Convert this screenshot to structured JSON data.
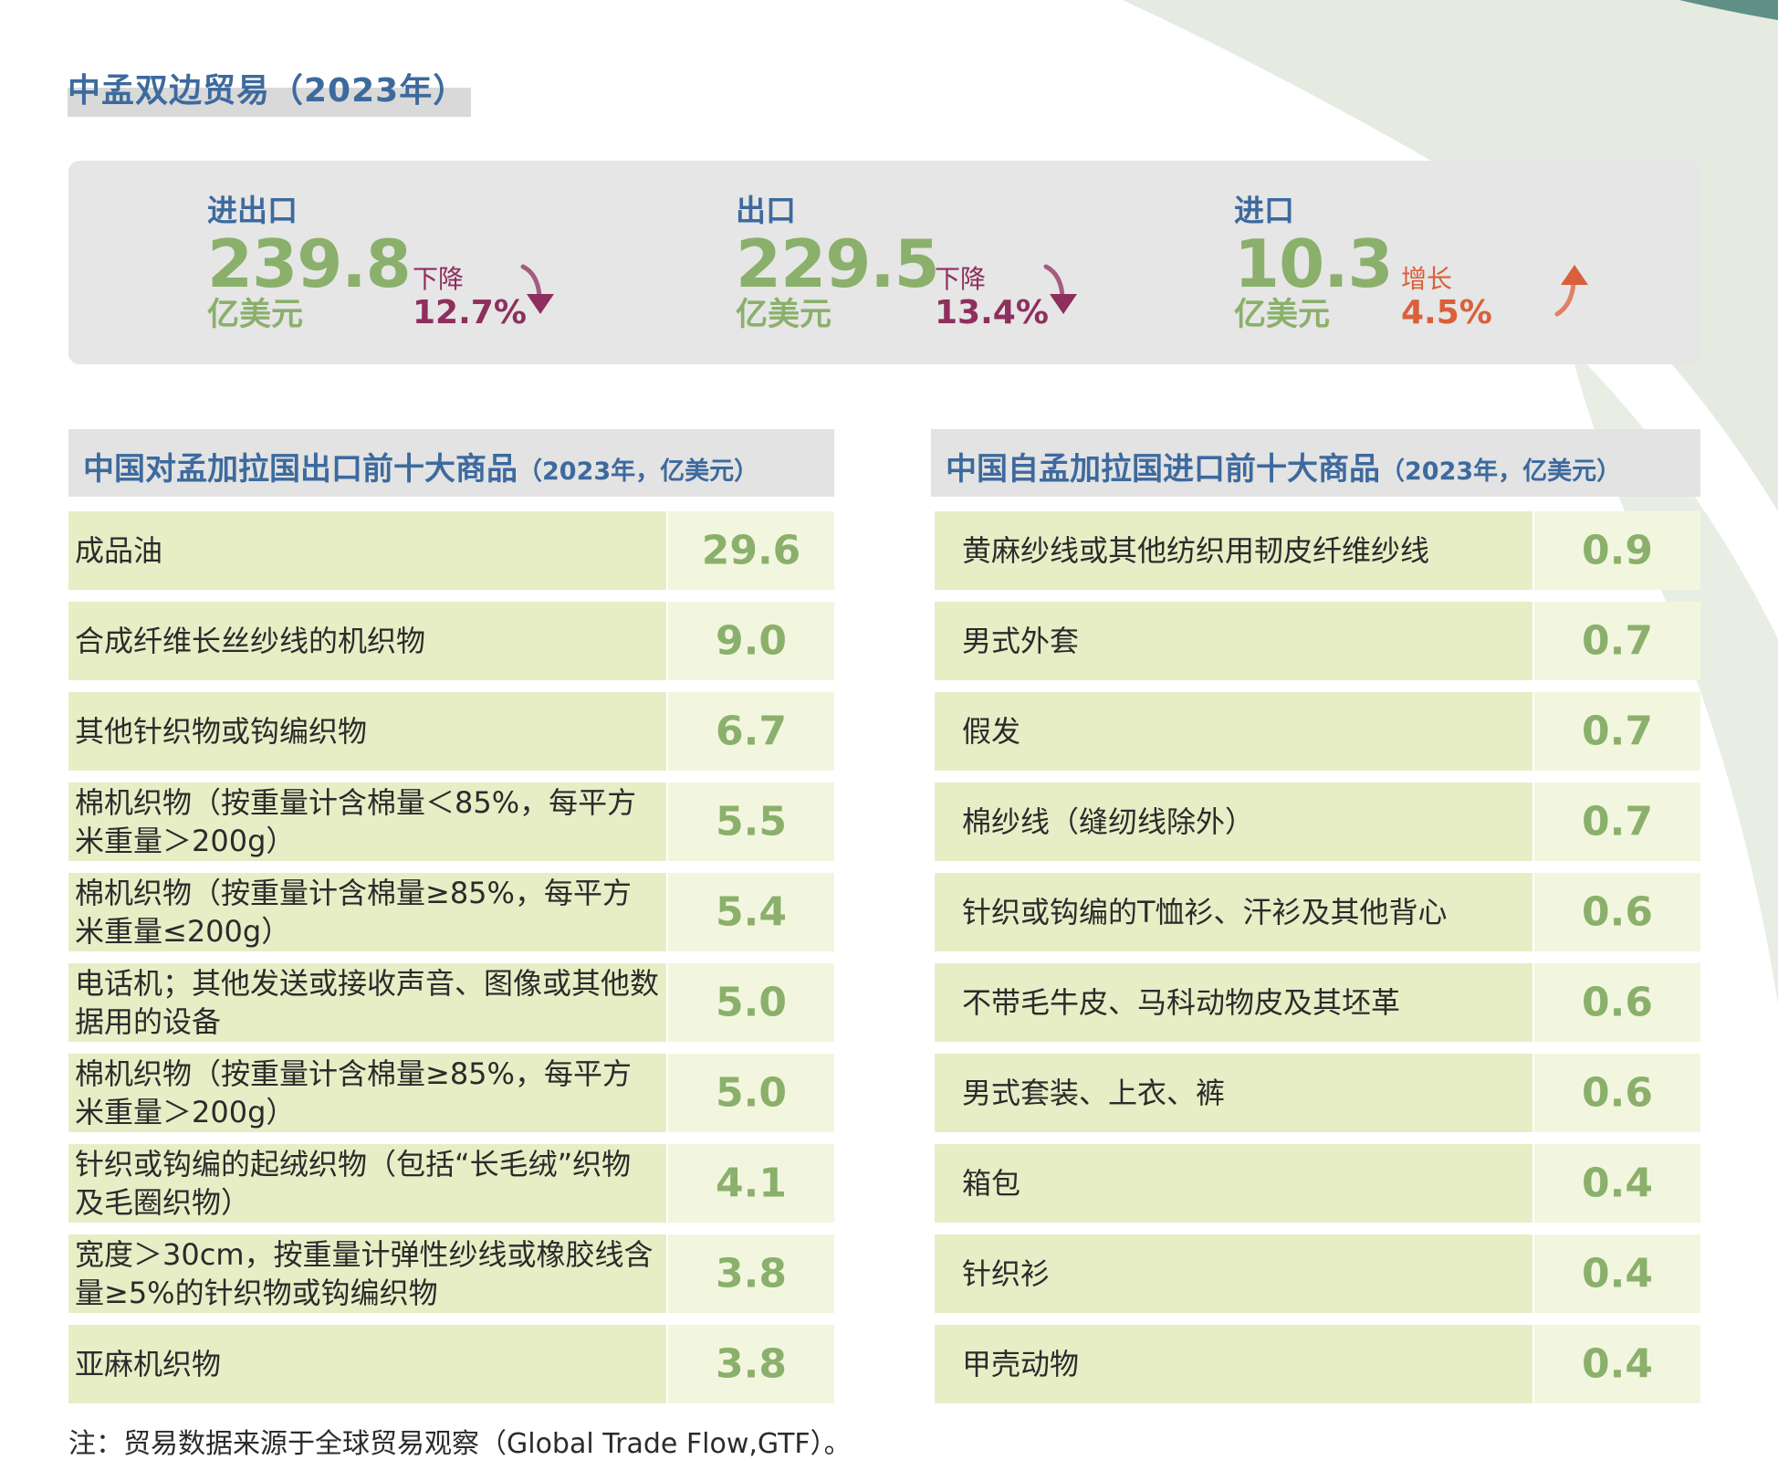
{
  "title": "中孟双边贸易（2023年）",
  "summary": {
    "total": {
      "label": "进出口",
      "value": "239.8",
      "unit": "亿美元",
      "change_label": "下降",
      "change_value": "12.7%",
      "direction": "down"
    },
    "export": {
      "label": "出口",
      "value": "229.5",
      "unit": "亿美元",
      "change_label": "下降",
      "change_value": "13.4%",
      "direction": "down"
    },
    "import": {
      "label": "进口",
      "value": "10.3",
      "unit": "亿美元",
      "change_label": "增长",
      "change_value": "4.5%",
      "direction": "up"
    }
  },
  "export_table": {
    "title": "中国对孟加拉国出口前十大商品",
    "subtitle": "（2023年，亿美元）",
    "rows": [
      {
        "name": "成品油",
        "value": "29.6"
      },
      {
        "name": "合成纤维长丝纱线的机织物",
        "value": "9.0"
      },
      {
        "name": "其他针织物或钩编织物",
        "value": "6.7"
      },
      {
        "name": "棉机织物（按重量计含棉量＜85%，每平方米重量＞200g）",
        "value": "5.5"
      },
      {
        "name": "棉机织物（按重量计含棉量≥85%，每平方米重量≤200g）",
        "value": "5.4"
      },
      {
        "name": "电话机；其他发送或接收声音、图像或其他数据用的设备",
        "value": "5.0"
      },
      {
        "name": "棉机织物（按重量计含棉量≥85%，每平方米重量＞200g）",
        "value": "5.0"
      },
      {
        "name": "针织或钩编的起绒织物（包括“长毛绒”织物及毛圈织物）",
        "value": "4.1"
      },
      {
        "name": "宽度＞30cm，按重量计弹性纱线或橡胶线含量≥5%的针织物或钩编织物",
        "value": "3.8"
      },
      {
        "name": "亚麻机织物",
        "value": "3.8"
      }
    ]
  },
  "import_table": {
    "title": "中国自孟加拉国进口前十大商品",
    "subtitle": "（2023年，亿美元）",
    "rows": [
      {
        "name": "黄麻纱线或其他纺织用韧皮纤维纱线",
        "value": "0.9"
      },
      {
        "name": "男式外套",
        "value": "0.7"
      },
      {
        "name": "假发",
        "value": "0.7"
      },
      {
        "name": "棉纱线（缝纫线除外）",
        "value": "0.7"
      },
      {
        "name": "针织或钩编的T恤衫、汗衫及其他背心",
        "value": "0.6"
      },
      {
        "name": "不带毛牛皮、马科动物皮及其坯革",
        "value": "0.6"
      },
      {
        "name": "男式套装、上衣、裤",
        "value": "0.6"
      },
      {
        "name": "箱包",
        "value": "0.4"
      },
      {
        "name": "针织衫",
        "value": "0.4"
      },
      {
        "name": "甲壳动物",
        "value": "0.4"
      }
    ]
  },
  "footnote": "注：贸易数据来源于全球贸易观察（Global Trade Flow,GTF）。",
  "colors": {
    "title_blue": "#3d6a9e",
    "value_green": "#8ab06b",
    "down_purple": "#8e2f5d",
    "up_orange": "#d9603a",
    "name_cell": "#e7eec6",
    "value_cell": "#f3f6de",
    "header_gray": "#e3e3e3"
  }
}
